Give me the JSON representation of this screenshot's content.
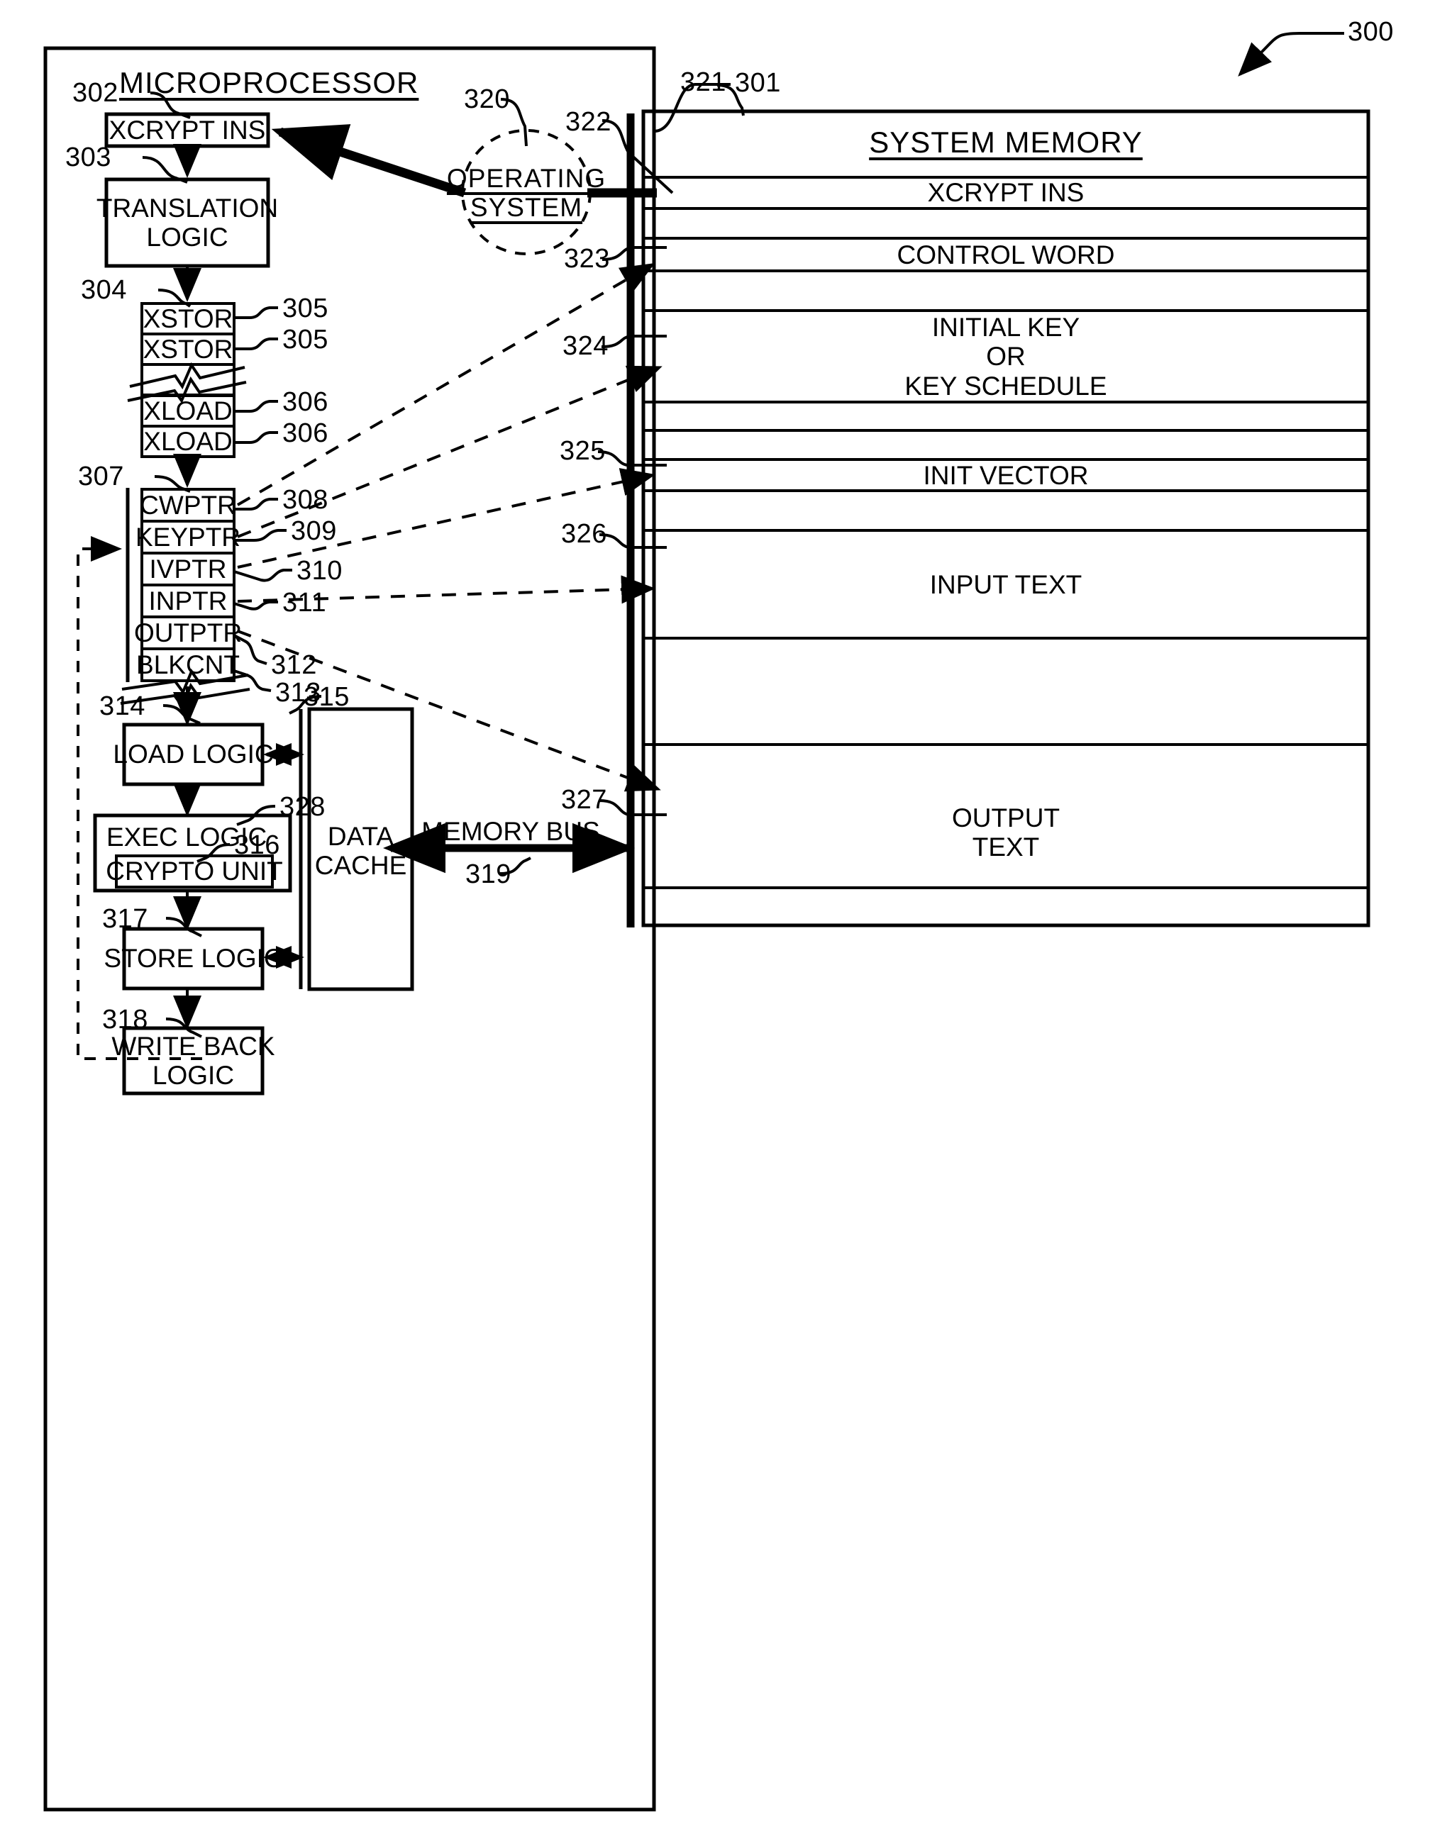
{
  "figure": {
    "number": "300",
    "domain": "patent-block-diagram"
  },
  "microprocessor": {
    "title": "MICROPROCESSOR",
    "ref": "301",
    "blocks": {
      "xcrypt_ins": {
        "label": "XCRYPT INS",
        "ref": "302"
      },
      "translation_logic": {
        "label": "TRANSLATION\nLOGIC",
        "ref": "303"
      },
      "micro_instruction_queue": {
        "ref": "304"
      },
      "load_logic": {
        "label": "LOAD LOGIC",
        "ref": "314"
      },
      "exec_logic": {
        "label": "EXEC LOGIC",
        "ref": "328"
      },
      "crypto_unit": {
        "label": "CRYPTO UNIT",
        "ref": "316"
      },
      "store_logic": {
        "label": "STORE LOGIC",
        "ref": "317"
      },
      "write_back_logic": {
        "label": "WRITE BACK\nLOGIC",
        "ref": "318"
      },
      "data_cache": {
        "label": "DATA\nCACHE",
        "ref": "315"
      }
    },
    "micro_ops": [
      {
        "label": "XSTOR",
        "ref": "305"
      },
      {
        "label": "XSTOR",
        "ref": "305"
      },
      {
        "label": "XLOAD",
        "ref": "306"
      },
      {
        "label": "XLOAD",
        "ref": "306"
      }
    ],
    "registers": {
      "ref": "307",
      "items": [
        {
          "label": "CWPTR",
          "ref": "308"
        },
        {
          "label": "KEYPTR",
          "ref": "309"
        },
        {
          "label": "IVPTR",
          "ref": "310"
        },
        {
          "label": "INPTR",
          "ref": "311"
        },
        {
          "label": "OUTPTR",
          "ref": "312"
        },
        {
          "label": "BLKCNT",
          "ref": "313"
        }
      ]
    }
  },
  "operating_system": {
    "label": "OPERATING\nSYSTEM",
    "label_line1": "OPERATING",
    "label_line2": "SYSTEM",
    "ref": "320"
  },
  "memory_bus": {
    "label": "MEMORY BUS",
    "ref": "319"
  },
  "system_memory": {
    "title": "SYSTEM MEMORY",
    "ref": "321",
    "rows": [
      {
        "label": "XCRYPT INS",
        "ref": "322"
      },
      {
        "label": "CONTROL WORD",
        "ref": "323"
      },
      {
        "label": "INITIAL KEY\nOR\nKEY SCHEDULE",
        "ref": "324",
        "line1": "INITIAL KEY",
        "line2": "OR",
        "line3": "KEY SCHEDULE"
      },
      {
        "label": "INIT VECTOR",
        "ref": "325"
      },
      {
        "label": "INPUT TEXT",
        "ref": "326"
      },
      {
        "label": "OUTPUT\nTEXT",
        "ref": "327",
        "line1": "OUTPUT",
        "line2": "TEXT"
      }
    ]
  },
  "colors": {
    "ink": "#000000",
    "paper": "#ffffff"
  }
}
